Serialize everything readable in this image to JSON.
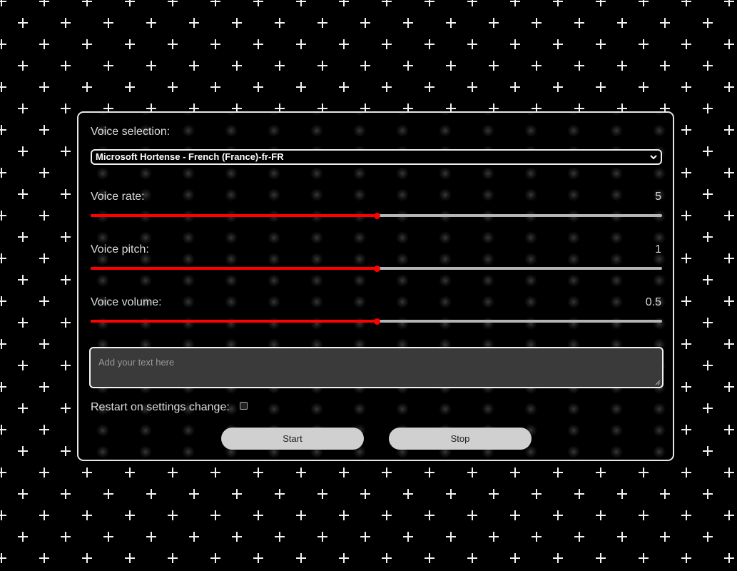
{
  "voice_selection": {
    "label": "Voice selection:",
    "selected": "Microsoft Hortense - French (France)-fr-FR"
  },
  "rate": {
    "label": "Voice rate:",
    "value": "5",
    "fraction": 0.5
  },
  "pitch": {
    "label": "Voice pitch:",
    "value": "1",
    "fraction": 0.5
  },
  "volume": {
    "label": "Voice volume:",
    "value": "0.5",
    "fraction": 0.5
  },
  "text_input": {
    "placeholder": "Add your text here"
  },
  "restart": {
    "label": "Restart on settings change:",
    "checked": false
  },
  "buttons": {
    "start": "Start",
    "stop": "Stop"
  },
  "colors": {
    "accent": "#ff0000",
    "track": "#b5b5b5",
    "button": "#d0d0d0",
    "background": "#000000"
  },
  "icons": {
    "background_pattern": "plus-icon",
    "select_arrow": "chevron-down-icon",
    "textarea_grip": "resize-grip-icon"
  }
}
